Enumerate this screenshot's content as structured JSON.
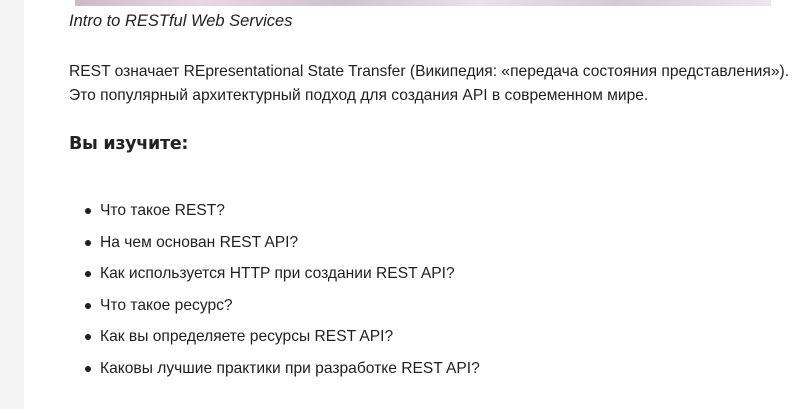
{
  "hero_image": {
    "caption": "Intro to RESTful Web Services"
  },
  "intro": {
    "line1": "REST означает REpresentational State Transfer (Википедия: «передача состояния представления»).",
    "line2": "Это популярный архитектурный подход для создания API в современном мире."
  },
  "section": {
    "heading": "Вы изучите:",
    "topics": [
      "Что такое REST?",
      "На чем основан REST API?",
      "Как используется HTTP при создании REST API?",
      "Что такое ресурс?",
      "Как вы определяете ресурсы REST API?",
      "Каковы лучшие практики при разработке REST API?"
    ]
  },
  "colors": {
    "text": "#1f1f1f",
    "background": "#ffffff",
    "gutter": "#f4f4f4"
  }
}
